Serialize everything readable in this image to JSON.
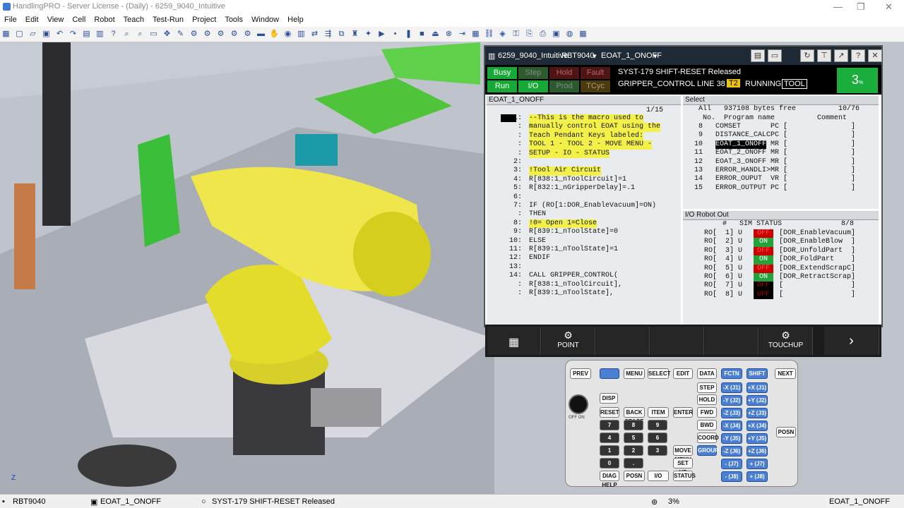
{
  "window": {
    "title": "HandlingPRO - Server License - (Daily) - 6259_9040_Intuitive",
    "minimize": "—",
    "maximize": "❐",
    "close": "✕"
  },
  "menu": [
    "File",
    "Edit",
    "View",
    "Cell",
    "Robot",
    "Teach",
    "Test-Run",
    "Project",
    "Tools",
    "Window",
    "Help"
  ],
  "toolbar_icons": [
    "grid-icon",
    "new-icon",
    "open-icon",
    "save-icon",
    "undo-icon",
    "redo-icon",
    "chart-icon",
    "bars-icon",
    "help-icon",
    "zoom-icon",
    "zoom-out-icon",
    "zoom-window-icon",
    "move-icon",
    "pencil-icon",
    "robot-icon",
    "robot2-icon",
    "robot3-icon",
    "robot4-icon",
    "robot5-icon",
    "ruler-icon",
    "hand-icon",
    "camera-icon",
    "teach-pendant-icon",
    "io-icon",
    "flow-icon",
    "group-icon",
    "tool-icon",
    "bulb-icon",
    "play-icon",
    "dot-icon",
    "pause-icon",
    "stop-icon",
    "eject-icon",
    "reset-icon",
    "step-icon",
    "table-icon",
    "link-icon",
    "layer-icon",
    "key-icon",
    "copy-icon",
    "clip-icon",
    "box-icon",
    "online-icon",
    "grid2-icon"
  ],
  "pendant": {
    "header": {
      "cell": "6259_9040_Intuitive",
      "robot": "RBT9040",
      "program": "EOAT_1_ONOFF"
    },
    "status": {
      "busy": "Busy",
      "step": "Step",
      "hold": "Hold",
      "fault": "Fault",
      "run": "Run",
      "io": "I/O",
      "prod": "Prod",
      "tcyc": "TCyc",
      "alarm": "SYST-179 SHIFT-RESET Released",
      "line": "GRIPPER_CONTROL LINE 38",
      "t2": "T2",
      "running": "RUNNING",
      "tool": "TOOL",
      "override": "3",
      "override_unit": "%"
    },
    "editor": {
      "title": "EOAT_1_ONOFF",
      "count": "1/15",
      "lines": [
        {
          "n": "1:",
          "t": "--This is the macro used to",
          "hl": true
        },
        {
          "n": ":",
          "t": "manually control EOAT using the",
          "hl": true
        },
        {
          "n": ":",
          "t": "Teach Pendant Keys labeled:",
          "hl": true
        },
        {
          "n": ":",
          "t": "TOOL 1 - TOOL 2 - MOVE MENU -",
          "hl": true
        },
        {
          "n": ":",
          "t": "SETUP - IO - STATUS",
          "hl": true
        },
        {
          "n": "2:",
          "t": "",
          "hl": false
        },
        {
          "n": "3:",
          "t": "!Tool Air Circuit",
          "hl": true
        },
        {
          "n": "4:",
          "t": "R[838:1_nToolCircuit]=1",
          "hl": false
        },
        {
          "n": "5:",
          "t": "R[832:1_nGripperDelay]=.1",
          "hl": false
        },
        {
          "n": "6:",
          "t": "",
          "hl": false
        },
        {
          "n": "7:",
          "t": "IF (RO[1:DOR_EnableVacuum]=ON)",
          "hl": false
        },
        {
          "n": ":",
          "t": "THEN",
          "hl": false
        },
        {
          "n": "8:",
          "t": "!0= Open 1=Close",
          "hl": true
        },
        {
          "n": "9:",
          "t": "R[839:1_nToolState]=0",
          "hl": false
        },
        {
          "n": "10:",
          "t": "ELSE",
          "hl": false
        },
        {
          "n": "11:",
          "t": "R[839:1_nToolState]=1",
          "hl": false
        },
        {
          "n": "12:",
          "t": "ENDIF",
          "hl": false
        },
        {
          "n": "13:",
          "t": "",
          "hl": false
        },
        {
          "n": "14:",
          "t": "CALL GRIPPER_CONTROL(",
          "hl": false
        },
        {
          "n": ":",
          "t": "R[838:1_nToolCircuit],",
          "hl": false
        },
        {
          "n": ":",
          "t": "R[839:1_nToolState],",
          "hl": false
        }
      ]
    },
    "select": {
      "title": "Select",
      "header": "All   937108 bytes free          10/76",
      "cols": "No.  Program name          Comment",
      "rows": [
        "  8   COMSET       PC [               ]",
        "  9   DISTANCE_CALCPC [               ]",
        " 10   EOAT_1_ONOFF MR [               ]",
        " 11   EOAT_2_ONOFF MR [               ]",
        " 12   EOAT_3_ONOFF MR [               ]",
        " 13   ERROR_HANDLI>MR [               ]",
        " 14   ERROR_OUPUT  VR [               ]",
        " 15   ERROR_OUTPUT PC [               ]"
      ],
      "selected_name": "EOAT_1_ONOFF"
    },
    "io": {
      "title": "I/O Robot Out",
      "header": "#   SIM STATUS              8/8",
      "rows": [
        {
          "p": "RO[  1] U",
          "s": "OFF",
          "c": "[DOR_EnableVacuum]"
        },
        {
          "p": "RO[  2] U",
          "s": "ON",
          "c": "[DOR_EnableBlow  ]"
        },
        {
          "p": "RO[  3] U",
          "s": "OFF",
          "c": "[DOR_UnfoldPart  ]"
        },
        {
          "p": "RO[  4] U",
          "s": "ON",
          "c": "[DOR_FoldPart    ]"
        },
        {
          "p": "RO[  5] U",
          "s": "OFF",
          "c": "[DOR_ExtendScrapC]"
        },
        {
          "p": "RO[  6] U",
          "s": "ON",
          "c": "[DOR_RetractScrap]"
        },
        {
          "p": "RO[  7] U",
          "s": "OFF",
          "c": "[                ]"
        },
        {
          "p": "RO[  8] U",
          "s": "OFF",
          "c": "[                ]"
        }
      ]
    },
    "fkeys": {
      "point": "POINT",
      "touchup": "TOUCHUP"
    }
  },
  "keypad": {
    "prev": "PREV",
    "menu": "MENU",
    "select": "SELECT",
    "edit": "EDIT",
    "data": "DATA",
    "fctn": "FCTN",
    "shift": "SHIFT",
    "next": "NEXT",
    "disp": "DISP",
    "step": "STEP",
    "hold": "HOLD",
    "reset": "RESET",
    "backspace": "BACK SPACE",
    "item": "ITEM",
    "enter": "ENTER",
    "fwd": "FWD",
    "bwd": "BWD",
    "coord": "COORD",
    "group": "GROUP",
    "movemenu": "MOVE MENU",
    "setup": "SET UP",
    "diag": "DIAG HELP",
    "posn": "POSN",
    "io": "I/O",
    "status": "STATUS",
    "posn2": "POSN",
    "offon": "OFF ON",
    "digits": [
      "7",
      "8",
      "9",
      "4",
      "5",
      "6",
      "1",
      "2",
      "3",
      "0",
      "."
    ],
    "jogs": [
      "-X (J1)",
      "+X (J1)",
      "-Y (J2)",
      "+Y (J2)",
      "-Z (J3)",
      "+Z (J3)",
      "-X (J4)",
      "+X (J4)",
      "-Y (J5)",
      "+Y (J5)",
      "-Z (J6)",
      "+Z (J6)",
      "- (J7)",
      "+ (J7)",
      "- (J8)",
      "+ (J8)"
    ]
  },
  "statusbar": {
    "robot": "RBT9040",
    "program": "EOAT_1_ONOFF",
    "alarm": "SYST-179 SHIFT-RESET Released",
    "percent": "3%",
    "program2": "EOAT_1_ONOFF"
  }
}
